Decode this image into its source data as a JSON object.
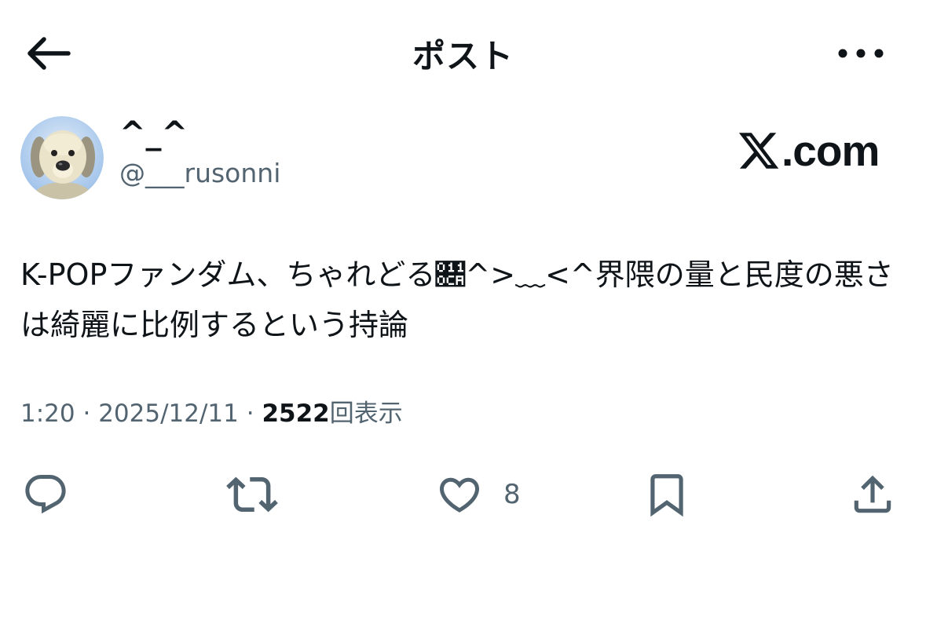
{
  "header": {
    "title": "ポスト",
    "back_icon": "arrow-left-icon",
    "more_icon": "ellipsis-icon"
  },
  "author": {
    "display_name": "^_^",
    "handle": "@___rusonni",
    "avatar": "dog-avatar"
  },
  "watermark": {
    "logo_icon": "x-logo-icon",
    "text": ".com"
  },
  "post": {
    "text": "K-POPファンダム、ちゃれどる𑃊^>﹏<^界隈の量と民度の悪さは綺麗に比例するという持論"
  },
  "meta": {
    "time": "1:20",
    "separator1": " · ",
    "date": "2025/12/11",
    "separator2": " · ",
    "views_count": "2522",
    "views_label": "回表示"
  },
  "actions": {
    "reply_icon": "reply-icon",
    "repost_icon": "repost-icon",
    "like_icon": "heart-icon",
    "like_count": "8",
    "bookmark_icon": "bookmark-icon",
    "share_icon": "share-icon"
  },
  "colors": {
    "text_primary": "#0f1419",
    "text_secondary": "#536471",
    "background": "#ffffff"
  }
}
